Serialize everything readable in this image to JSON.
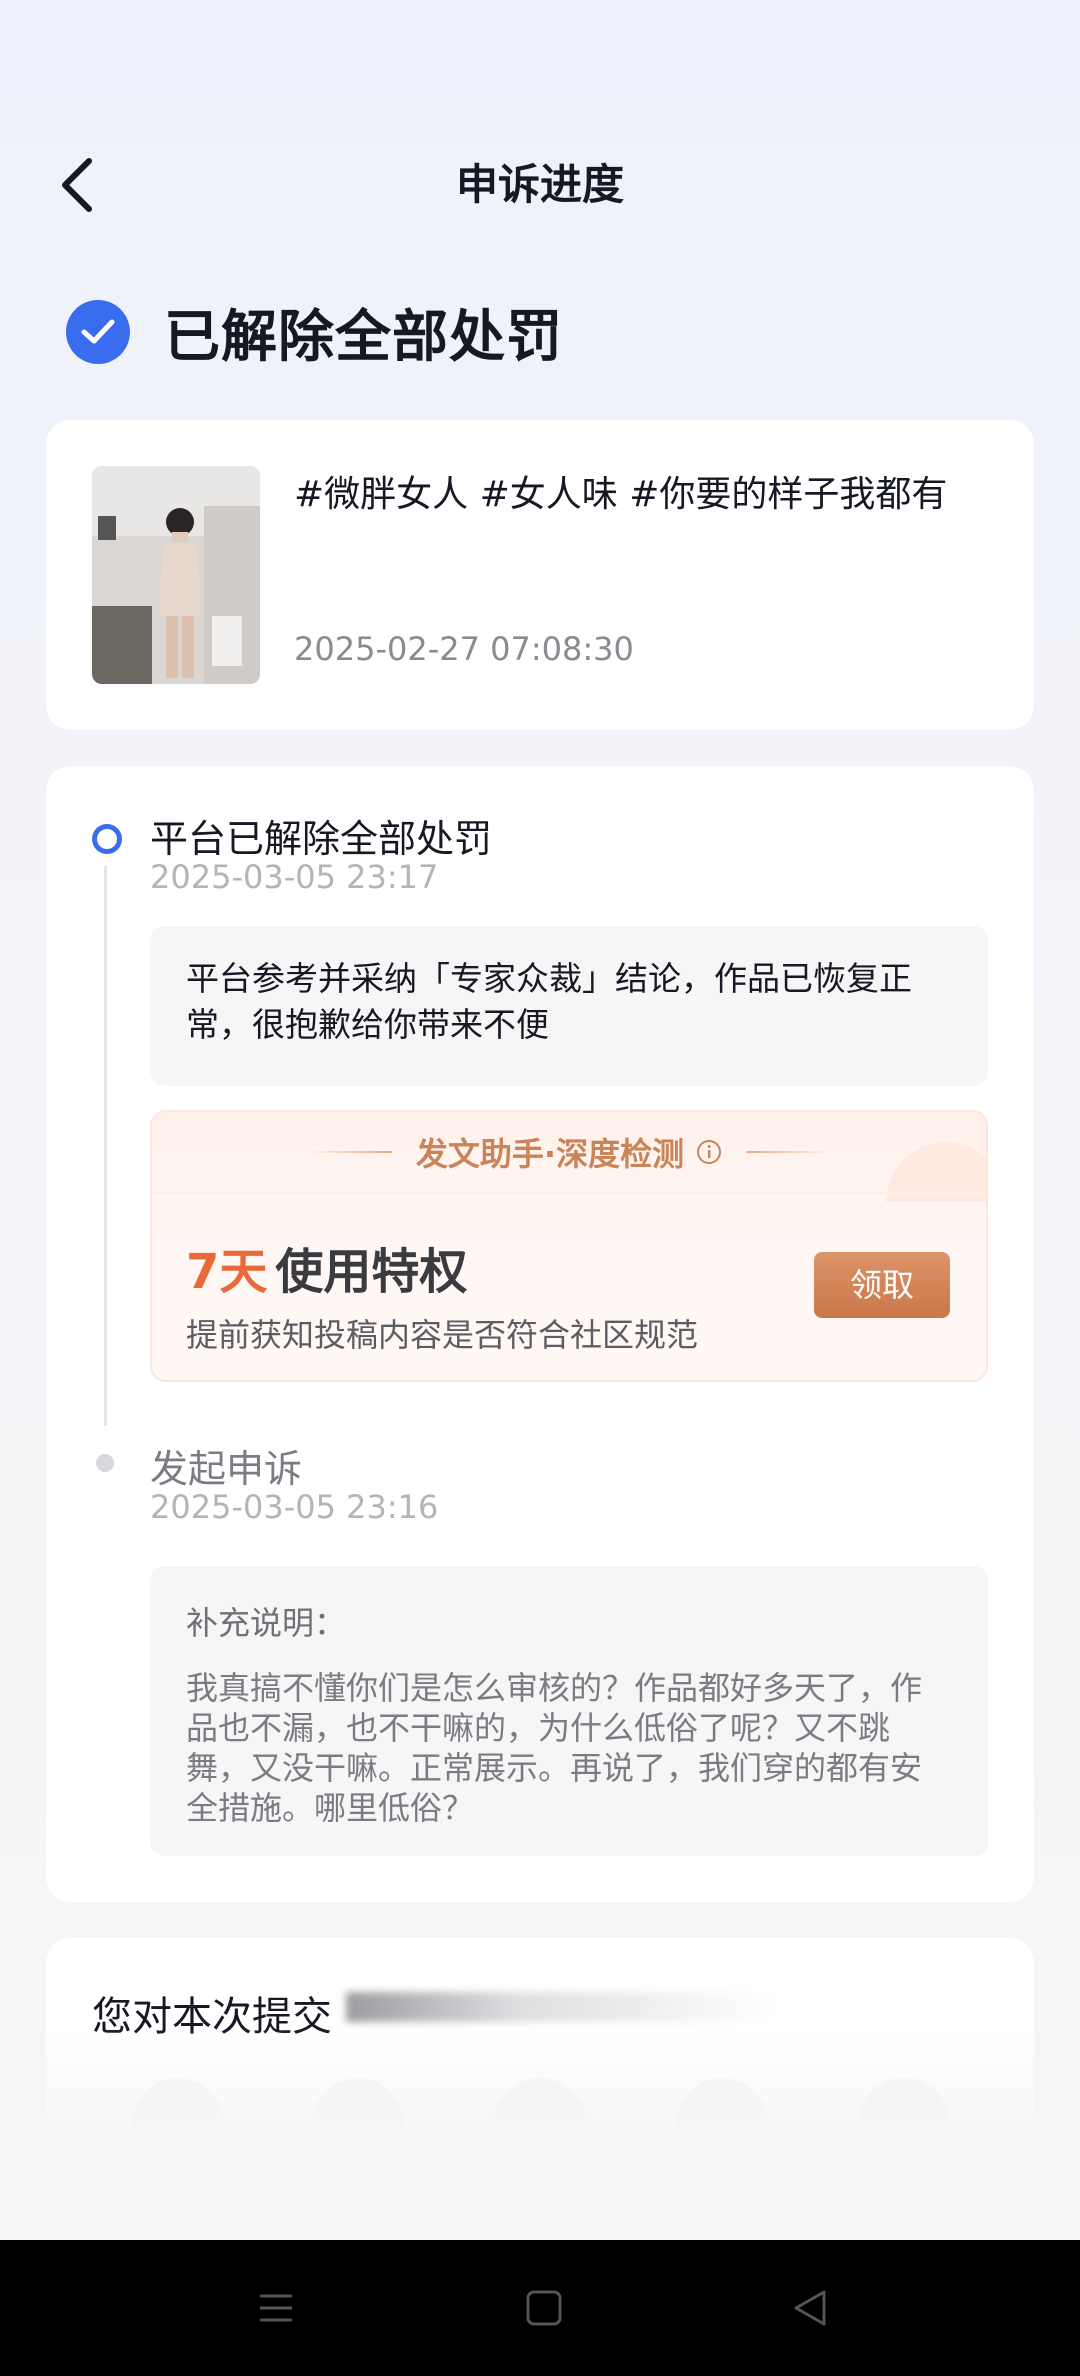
{
  "header": {
    "title": "申诉进度",
    "back_icon": "chevron-left-icon"
  },
  "status": {
    "text": "已解除全部处罚",
    "icon": "check-circle-icon",
    "color": "#3a6cf0"
  },
  "work": {
    "title": "#微胖女人 #女人味 #你要的样子我都有",
    "time": "2025-02-27 07:08:30"
  },
  "timeline": [
    {
      "title": "平台已解除全部处罚",
      "time": "2025-03-05 23:17",
      "note": "平台参考并采纳「专家众裁」结论，作品已恢复正常，很抱歉给你带来不便"
    },
    {
      "title": "发起申诉",
      "time": "2025-03-05 23:16",
      "note_label": "补充说明：",
      "note": "我真搞不懂你们是怎么审核的？作品都好多天了，作品也不漏，也不干嘛的，为什么低俗了呢？又不跳舞，又没干嘛。正常展示。再说了，我们穿的都有安全措施。哪里低俗？"
    }
  ],
  "promo": {
    "title": "发文助手·深度检测",
    "days": "7天",
    "privilege": "使用特权",
    "desc": "提前获知投稿内容是否符合社区规范",
    "button": "领取",
    "accent": "#e8693a"
  },
  "feedback": {
    "title": "您对本次提交",
    "emojis": [
      "very-angry-face-icon",
      "angry-face-icon",
      "neutral-face-icon",
      "smiling-face-icon",
      "heart-eyes-face-icon"
    ]
  },
  "system_nav": {
    "icons": [
      "menu-icon",
      "home-square-icon",
      "back-triangle-icon"
    ]
  }
}
